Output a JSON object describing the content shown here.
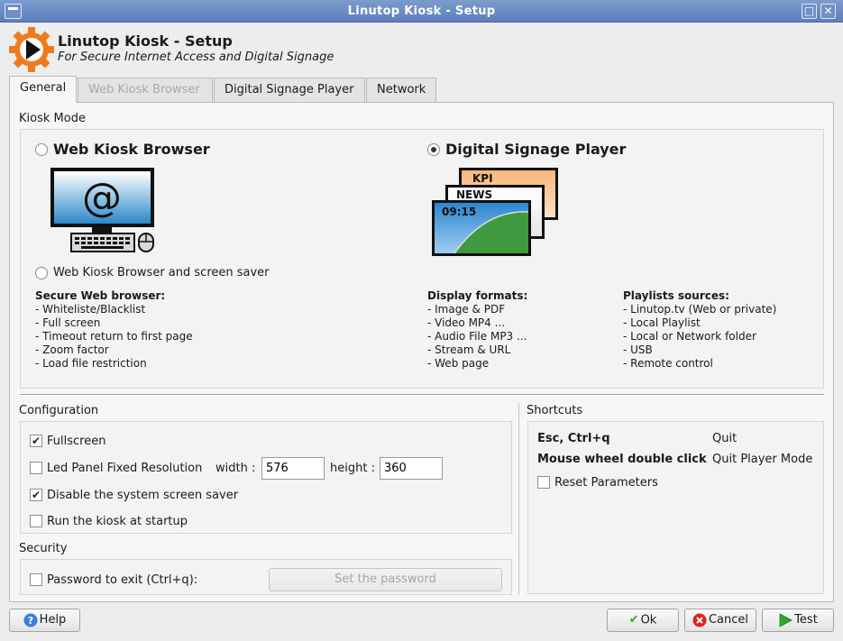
{
  "window": {
    "title": "Linutop Kiosk - Setup"
  },
  "header": {
    "title": "Linutop Kiosk - Setup",
    "subtitle": "For Secure Internet Access and Digital Signage"
  },
  "tabs": [
    {
      "label": "General",
      "state": "active"
    },
    {
      "label": "Web Kiosk Browser",
      "state": "disabled"
    },
    {
      "label": "Digital Signage Player",
      "state": "normal"
    },
    {
      "label": "Network",
      "state": "normal"
    }
  ],
  "kiosk_mode": {
    "title": "Kiosk Mode",
    "web_option": {
      "label": "Web Kiosk Browser",
      "selected": false
    },
    "signage_option": {
      "label": "Digital Signage Player",
      "selected": true
    },
    "saver_option": {
      "label": "Web Kiosk Browser and screen saver",
      "selected": false
    },
    "illustration": {
      "kpi": "KPI",
      "news": "NEWS",
      "clock": "09:15"
    },
    "web_features": {
      "heading": "Secure Web browser:",
      "items": [
        "- Whiteliste/Blacklist",
        "- Full screen",
        "- Timeout return to first page",
        "- Zoom factor",
        "- Load file restriction"
      ]
    },
    "formats": {
      "heading": "Display formats:",
      "items": [
        "- Image & PDF",
        "- Video MP4 ...",
        "- Audio File MP3 ...",
        "- Stream & URL",
        "- Web page"
      ]
    },
    "sources": {
      "heading": "Playlists sources:",
      "items": [
        "- Linutop.tv (Web or private)",
        "- Local Playlist",
        "- Local or Network folder",
        "- USB",
        "- Remote control"
      ]
    }
  },
  "configuration": {
    "title": "Configuration",
    "fullscreen": {
      "label": "Fullscreen",
      "checked": true
    },
    "led_panel": {
      "label": "Led Panel Fixed Resolution",
      "checked": false,
      "width_label": "width :",
      "width_value": "576",
      "height_label": "height :",
      "height_value": "360"
    },
    "disable_saver": {
      "label": "Disable the system screen saver",
      "checked": true
    },
    "startup": {
      "label": "Run the kiosk at startup",
      "checked": false
    }
  },
  "security": {
    "title": "Security",
    "password": {
      "label": "Password to exit (Ctrl+q):",
      "checked": false
    },
    "set_password_label": "Set the password"
  },
  "shortcuts": {
    "title": "Shortcuts",
    "rows": [
      {
        "key": "Esc, Ctrl+q",
        "action": "Quit"
      },
      {
        "key": "Mouse wheel double click",
        "action": "Quit Player Mode"
      }
    ],
    "reset": {
      "label": "Reset Parameters",
      "checked": false
    }
  },
  "footer": {
    "help_label": "Help",
    "ok_label": "Ok",
    "cancel_label": "Cancel",
    "test_label": "Test"
  },
  "colors": {
    "titlebar": "#5b7fbd",
    "logo_orange": "#f07b1e",
    "ok_green": "#2ea82e",
    "cancel_red": "#d22",
    "help_blue": "#3b7dd8"
  }
}
